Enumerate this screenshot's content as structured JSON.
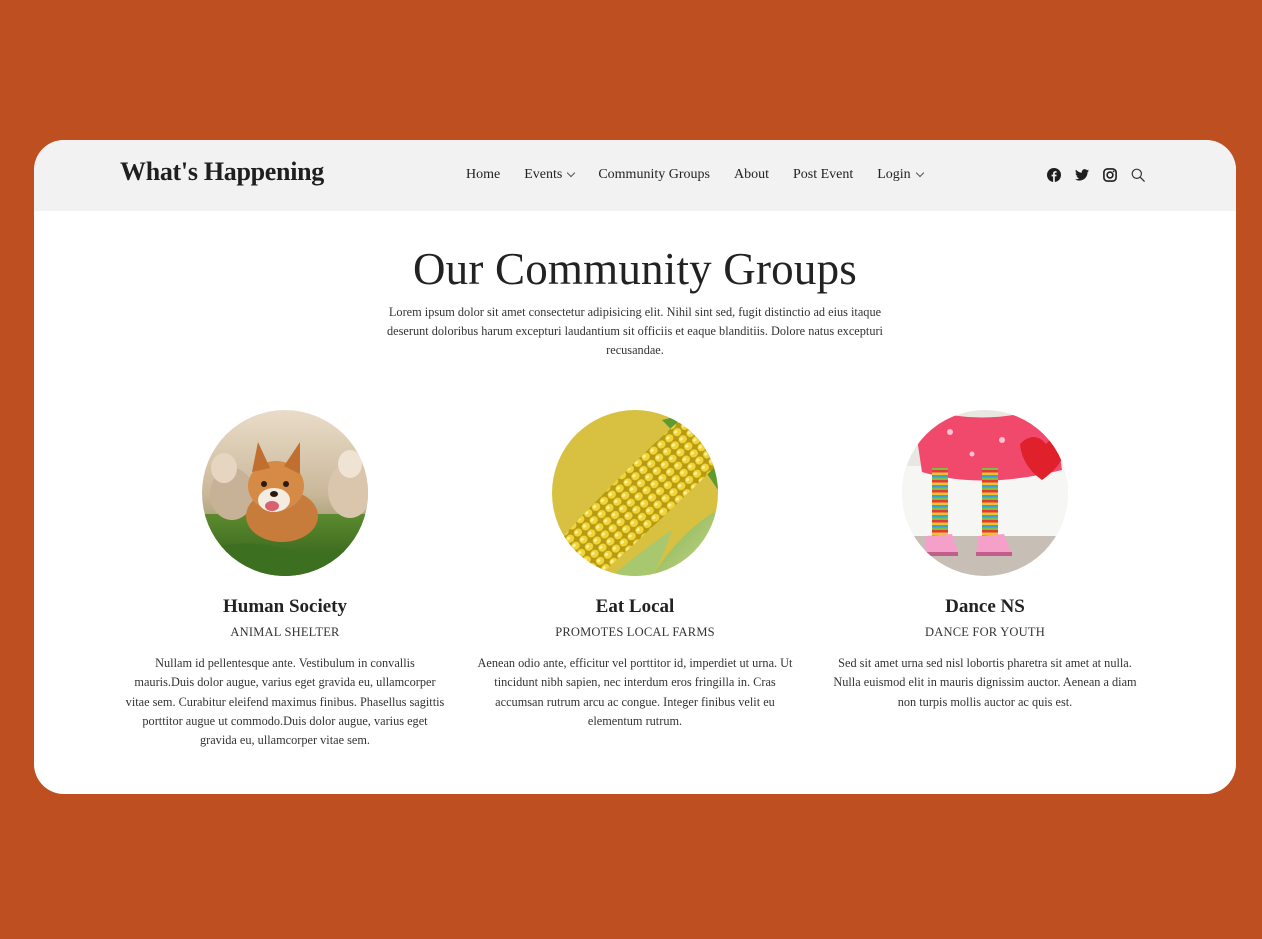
{
  "brand": "What's Happening",
  "nav": [
    {
      "label": "Home",
      "dropdown": false
    },
    {
      "label": "Events",
      "dropdown": true
    },
    {
      "label": "Community Groups",
      "dropdown": false
    },
    {
      "label": "About",
      "dropdown": false
    },
    {
      "label": "Post Event",
      "dropdown": false
    },
    {
      "label": "Login",
      "dropdown": true
    }
  ],
  "social_icons": [
    "facebook-icon",
    "twitter-icon",
    "instagram-icon",
    "search-icon"
  ],
  "colors": {
    "page_background": "#bd4f20",
    "header_background": "#f2f2f2",
    "card_background": "#ffffff",
    "text": "#222222"
  },
  "section": {
    "title": "Our Community Groups",
    "intro": "Lorem ipsum dolor sit amet consectetur adipisicing elit. Nihil sint sed, fugit distinctio ad eius itaque deserunt doloribus harum excepturi laudantium sit officiis et eaque blanditiis. Dolore natus excepturi recusandae."
  },
  "groups": [
    {
      "name": "Human Society",
      "tag": "ANIMAL SHELTER",
      "description": "Nullam id pellentesque ante. Vestibulum in convallis mauris.Duis dolor augue, varius eget gravida eu, ullamcorper vitae sem. Curabitur eleifend maximus finibus. Phasellus sagittis porttitor augue ut commodo.Duis dolor augue, varius eget gravida eu, ullamcorper vitae sem.",
      "image": "corgi-puppies-photo"
    },
    {
      "name": "Eat Local",
      "tag": "PROMOTES LOCAL FARMS",
      "description": "Aenean odio ante, efficitur vel porttitor id, imperdiet ut urna. Ut tincidunt nibh sapien, nec interdum eros fringilla in. Cras accumsan rutrum arcu ac congue. Integer finibus velit eu elementum rutrum.",
      "image": "corn-cob-photo"
    },
    {
      "name": "Dance NS",
      "tag": "DANCE FOR YOUTH",
      "description": "Sed sit amet urna sed nisl lobortis pharetra sit amet at nulla. Nulla euismod elit in mauris dignissim auctor. Aenean a diam non turpis mollis auctor ac quis est.",
      "image": "child-dancer-legs-photo"
    }
  ]
}
